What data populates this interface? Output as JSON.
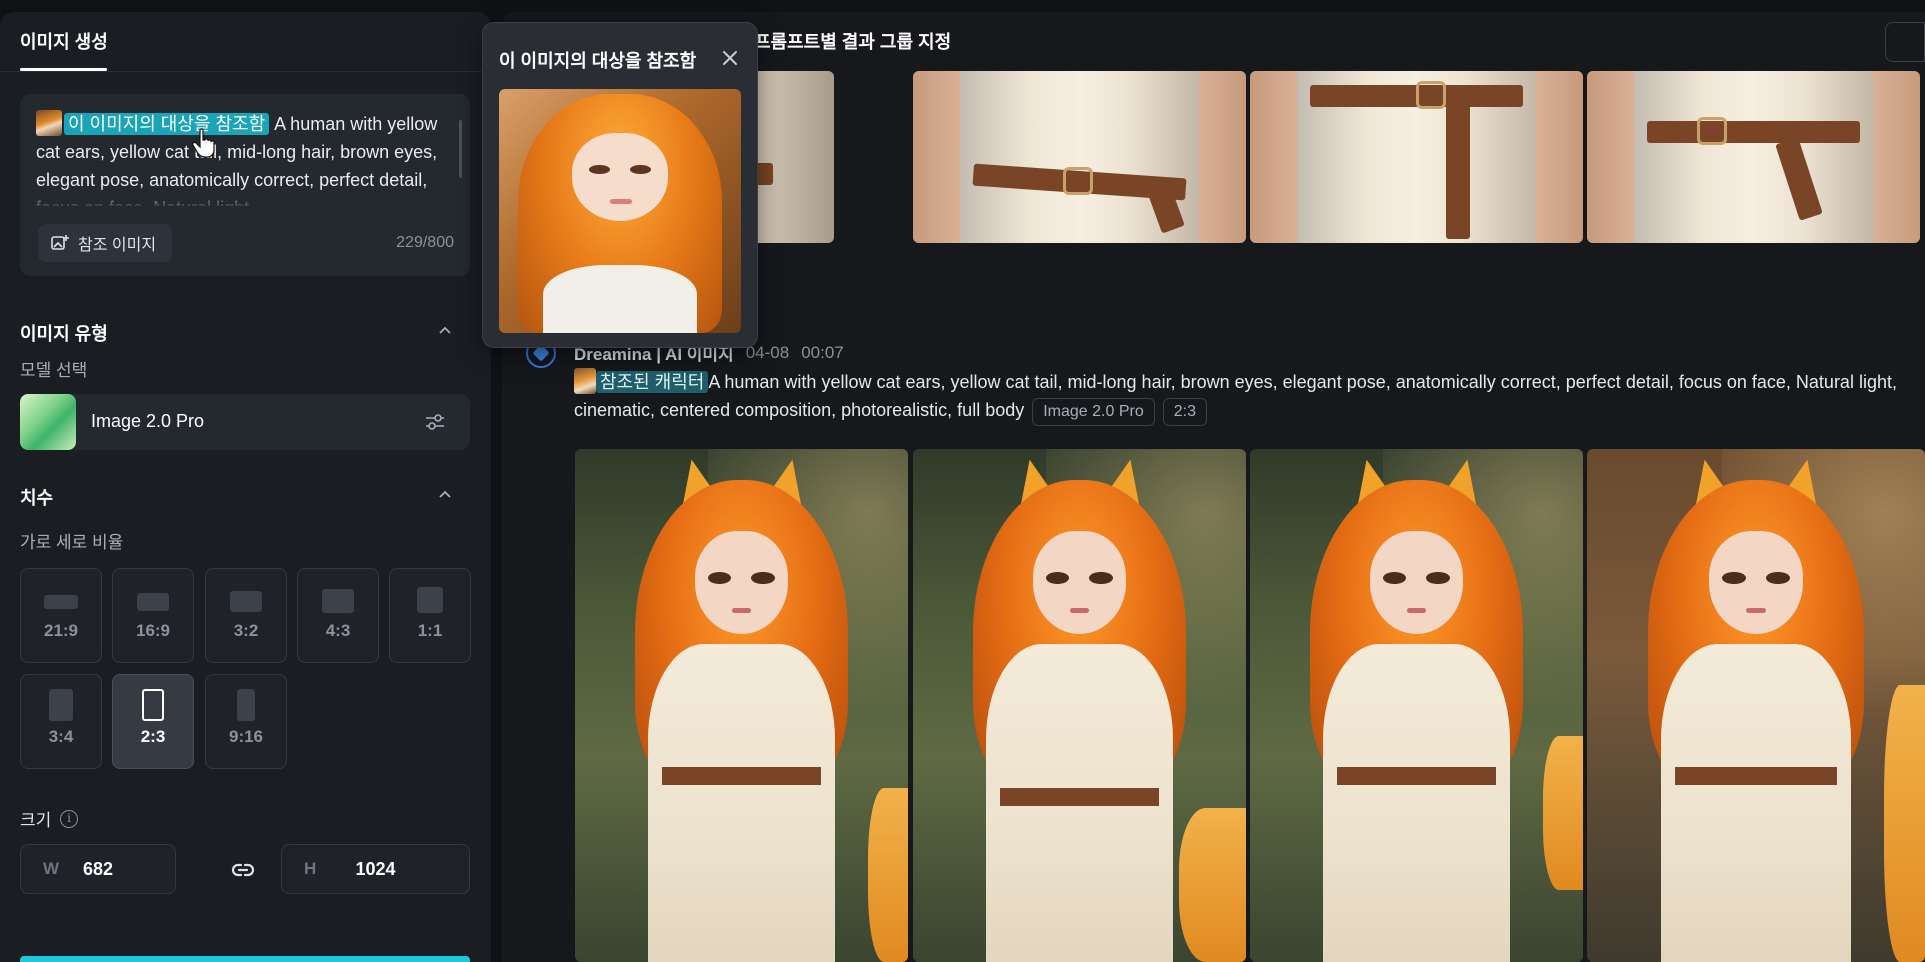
{
  "left_panel": {
    "tab_label": "이미지 생성",
    "prompt": {
      "chip_text": "이 이미지의 대상을 참조함",
      "text": " A human with yellow cat ears, yellow cat tail, mid-long hair, brown eyes, elegant pose, anatomically correct, perfect detail, focus on face, Natural light,",
      "reference_button": "참조 이미지",
      "char_count": "229/800"
    },
    "image_type": {
      "title": "이미지 유형",
      "model_label": "모델 선택",
      "model_name": "Image 2.0 Pro"
    },
    "dimensions": {
      "title": "치수",
      "ratio_label": "가로 세로 비율",
      "ratios": [
        "21:9",
        "16:9",
        "3:2",
        "4:3",
        "1:1",
        "3:4",
        "2:3",
        "9:16"
      ],
      "selected_ratio": "2:3",
      "size_label": "크기",
      "width_prefix": "W",
      "width_value": "682",
      "height_prefix": "H",
      "height_value": "1024"
    }
  },
  "main": {
    "header_text": "프롬프트별 결과 그룹 지정",
    "generation": {
      "author": "Dreamina | AI 이미지",
      "date": "04-08",
      "time": "00:07",
      "chip_text": "참조된 캐릭터",
      "prompt": "A human with yellow cat ears, yellow cat tail, mid-long hair, brown eyes, elegant pose, anatomically correct, perfect detail, focus on face, Natural light, cinematic, centered composition, photorealistic, full body",
      "tags": [
        "Image 2.0 Pro",
        "2:3"
      ]
    }
  },
  "popup": {
    "title": "이 이미지의 대상을 참조함"
  },
  "colors": {
    "accent": "#1fc8d8",
    "chip": "#1aa4b8",
    "panel": "#1a1d22",
    "background": "#0f1115"
  }
}
